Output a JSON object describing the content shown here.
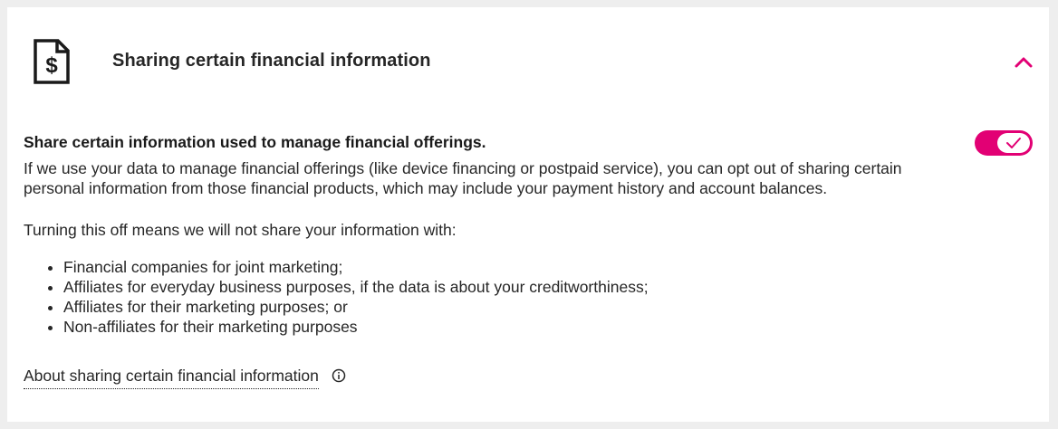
{
  "header": {
    "title": "Sharing certain financial information",
    "icon": "financial-document-icon",
    "collapse_icon": "chevron-up-icon"
  },
  "section": {
    "title": "Share certain information used to manage financial offerings.",
    "description": "If we use your data to manage financial offerings (like device financing or postpaid service), you can opt out of sharing certain personal information from those financial products, which may include your payment history and account balances.",
    "toggle_on": true,
    "turning_off_text": "Turning this off means we will not share your information with:",
    "bullets": [
      "Financial companies for joint marketing;",
      "Affiliates for everyday business purposes, if the data is about your creditworthiness;",
      "Affiliates for their marketing purposes; or",
      "Non-affiliates for their marketing purposes"
    ],
    "about_link": "About sharing certain financial information",
    "info_icon": "info-icon"
  },
  "colors": {
    "accent": "#e20074",
    "text": "#262626",
    "background": "#eeeeee",
    "card": "#ffffff"
  }
}
